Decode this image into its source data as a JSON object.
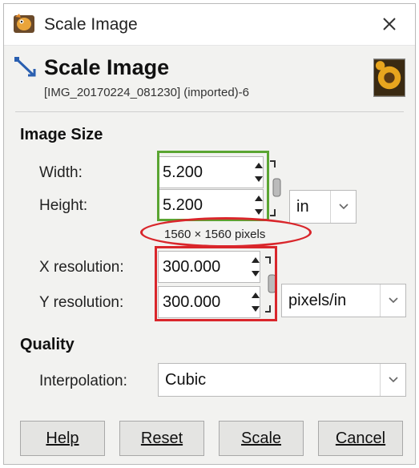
{
  "window": {
    "title": "Scale Image",
    "app_icon": "gimp-icon",
    "close_icon": "close-icon"
  },
  "header": {
    "title": "Scale Image",
    "subtitle": "[IMG_20170224_081230] (imported)-6",
    "icon": "scale-image-icon",
    "thumbnail": "sunflower-thumbnail"
  },
  "image_size": {
    "section_title": "Image Size",
    "width_label": "Width:",
    "width_value": "5.200",
    "height_label": "Height:",
    "height_value": "5.200",
    "unit": "in",
    "pixel_info": "1560 × 1560 pixels",
    "x_res_label": "X resolution:",
    "x_res_value": "300.000",
    "y_res_label": "Y resolution:",
    "y_res_value": "300.000",
    "res_unit": "pixels/in",
    "chain_icon": "chain-link-icon"
  },
  "quality": {
    "section_title": "Quality",
    "interp_label": "Interpolation:",
    "interp_value": "Cubic"
  },
  "buttons": {
    "help": "Help",
    "reset": "Reset",
    "scale": "Scale",
    "cancel": "Cancel"
  },
  "colors": {
    "annotation_green": "#5aa532",
    "annotation_red": "#d9262b",
    "dialog_bg": "#f2f2f0"
  }
}
